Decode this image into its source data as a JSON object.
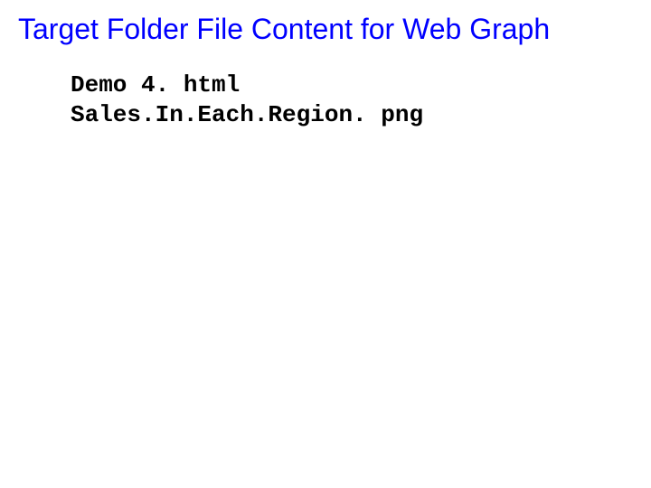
{
  "title": "Target Folder File Content for Web Graph",
  "files": [
    "Demo 4. html",
    "Sales.In.Each.Region. png"
  ]
}
